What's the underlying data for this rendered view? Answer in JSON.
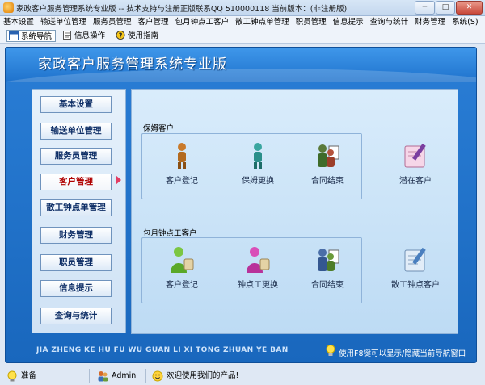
{
  "window": {
    "title": "家政客户服务管理系统专业版 -- 技术支持与注册正版联系QQ 510000118    当前版本：(非注册版)",
    "min_label": "─",
    "max_label": "□",
    "close_label": "✕"
  },
  "menu": {
    "items": [
      "基本设置",
      "输送单位管理",
      "服务员管理",
      "客户管理",
      "包月钟点工客户",
      "散工钟点单管理",
      "职员管理",
      "信息提示",
      "查询与统计",
      "财务管理",
      "系统(S)"
    ]
  },
  "toolbar": {
    "items": [
      "系统导航",
      "信息操作",
      "使用指南"
    ]
  },
  "banner": {
    "title": "家政客户服务管理系统专业版"
  },
  "nav": {
    "items": [
      "基本设置",
      "输送单位管理",
      "服务员管理",
      "客户管理",
      "散工钟点单管理",
      "财务管理",
      "职员管理",
      "信息提示",
      "查询与统计"
    ],
    "active_index": 3
  },
  "content": {
    "group1": {
      "label": "保姆客户",
      "items": [
        "客户登记",
        "保姆更换",
        "合同结束"
      ],
      "extra": "潜在客户"
    },
    "group2": {
      "label": "包月钟点工客户",
      "items": [
        "客户登记",
        "钟点工更换",
        "合同结束"
      ],
      "extra": "散工钟点客户"
    }
  },
  "footer": {
    "pinyin": "JIA ZHENG KE HU FU WU GUAN LI XI TONG ZHUAN YE BAN",
    "hint": "使用F8键可以显示/隐藏当前导航窗口"
  },
  "status": {
    "state": "准备",
    "user": "Admin",
    "welcome": "欢迎使用我们的产品!"
  },
  "colors": {
    "accent": "#1f73cd",
    "active_nav_text": "#b00000",
    "arrow": "#e33d63"
  },
  "icons": {
    "customer": "person-icon",
    "swap": "person-swap-icon",
    "contract_end": "group-contract-icon",
    "potential": "notebook-pen-icon"
  }
}
